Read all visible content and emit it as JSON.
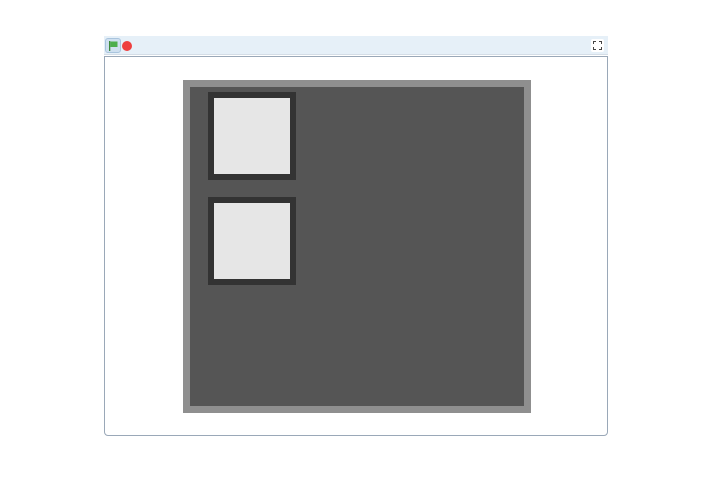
{
  "toolbar": {
    "green_flag": {
      "icon": "green-flag-icon",
      "color": "#4cae4c"
    },
    "stop": {
      "icon": "stop-icon",
      "color": "#ee3f3f"
    },
    "fullscreen": {
      "icon": "fullscreen-icon"
    }
  },
  "stage": {
    "board": {
      "frame_color": "#8f8f8f",
      "fill_color": "#555555",
      "cells": [
        {
          "border_color": "#333333",
          "fill_color": "#e6e6e6"
        },
        {
          "border_color": "#333333",
          "fill_color": "#e6e6e6"
        }
      ]
    }
  }
}
